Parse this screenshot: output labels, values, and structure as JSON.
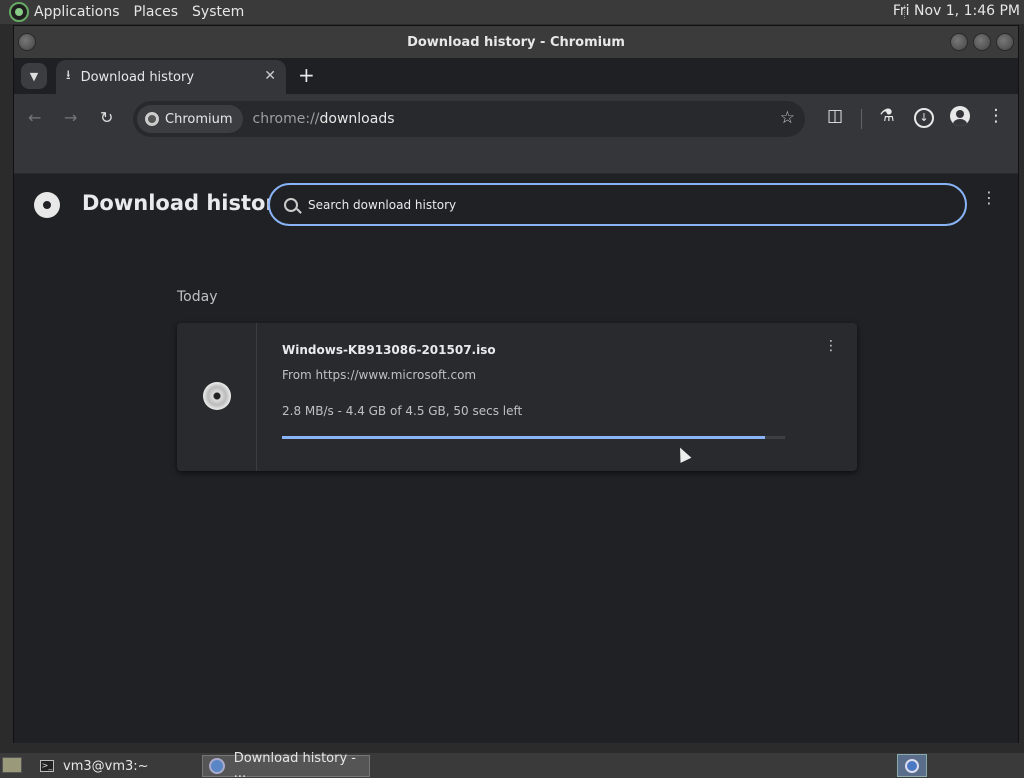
{
  "top_panel": {
    "menus": [
      "Applications",
      "Places",
      "System"
    ],
    "clock": "Fri Nov 1,  1:46 PM"
  },
  "window": {
    "title": "Download history - Chromium"
  },
  "tabs": [
    {
      "label": "Download history",
      "icon": "download-icon"
    }
  ],
  "toolbar": {
    "site_chip": "Chromium",
    "url_scheme": "chrome://",
    "url_host": "downloads",
    "icons": [
      "back-icon",
      "forward-icon",
      "reload-icon",
      "star-icon",
      "extensions-icon",
      "labs-icon",
      "download-icon",
      "profile-icon",
      "menu-icon"
    ]
  },
  "page": {
    "title": "Download history",
    "search_placeholder": "Search download history",
    "section_label": "Today",
    "downloads": [
      {
        "file_name": "Windows-KB913086-201507.iso",
        "source": "From https://www.microsoft.com",
        "status": "2.8 MB/s - 4.4 GB of 4.5 GB, 50 secs left",
        "progress": 0.96,
        "icon": "disc-icon"
      }
    ]
  },
  "taskbar": {
    "tasks": [
      {
        "label": "vm3@vm3:~",
        "icon": "terminal-icon",
        "active": false
      },
      {
        "label": "Download history - ...",
        "icon": "chromium-icon",
        "active": true
      }
    ]
  },
  "colors": {
    "accent": "#8ab4f8",
    "page_bg": "#202124",
    "card_bg": "#292a2d"
  }
}
